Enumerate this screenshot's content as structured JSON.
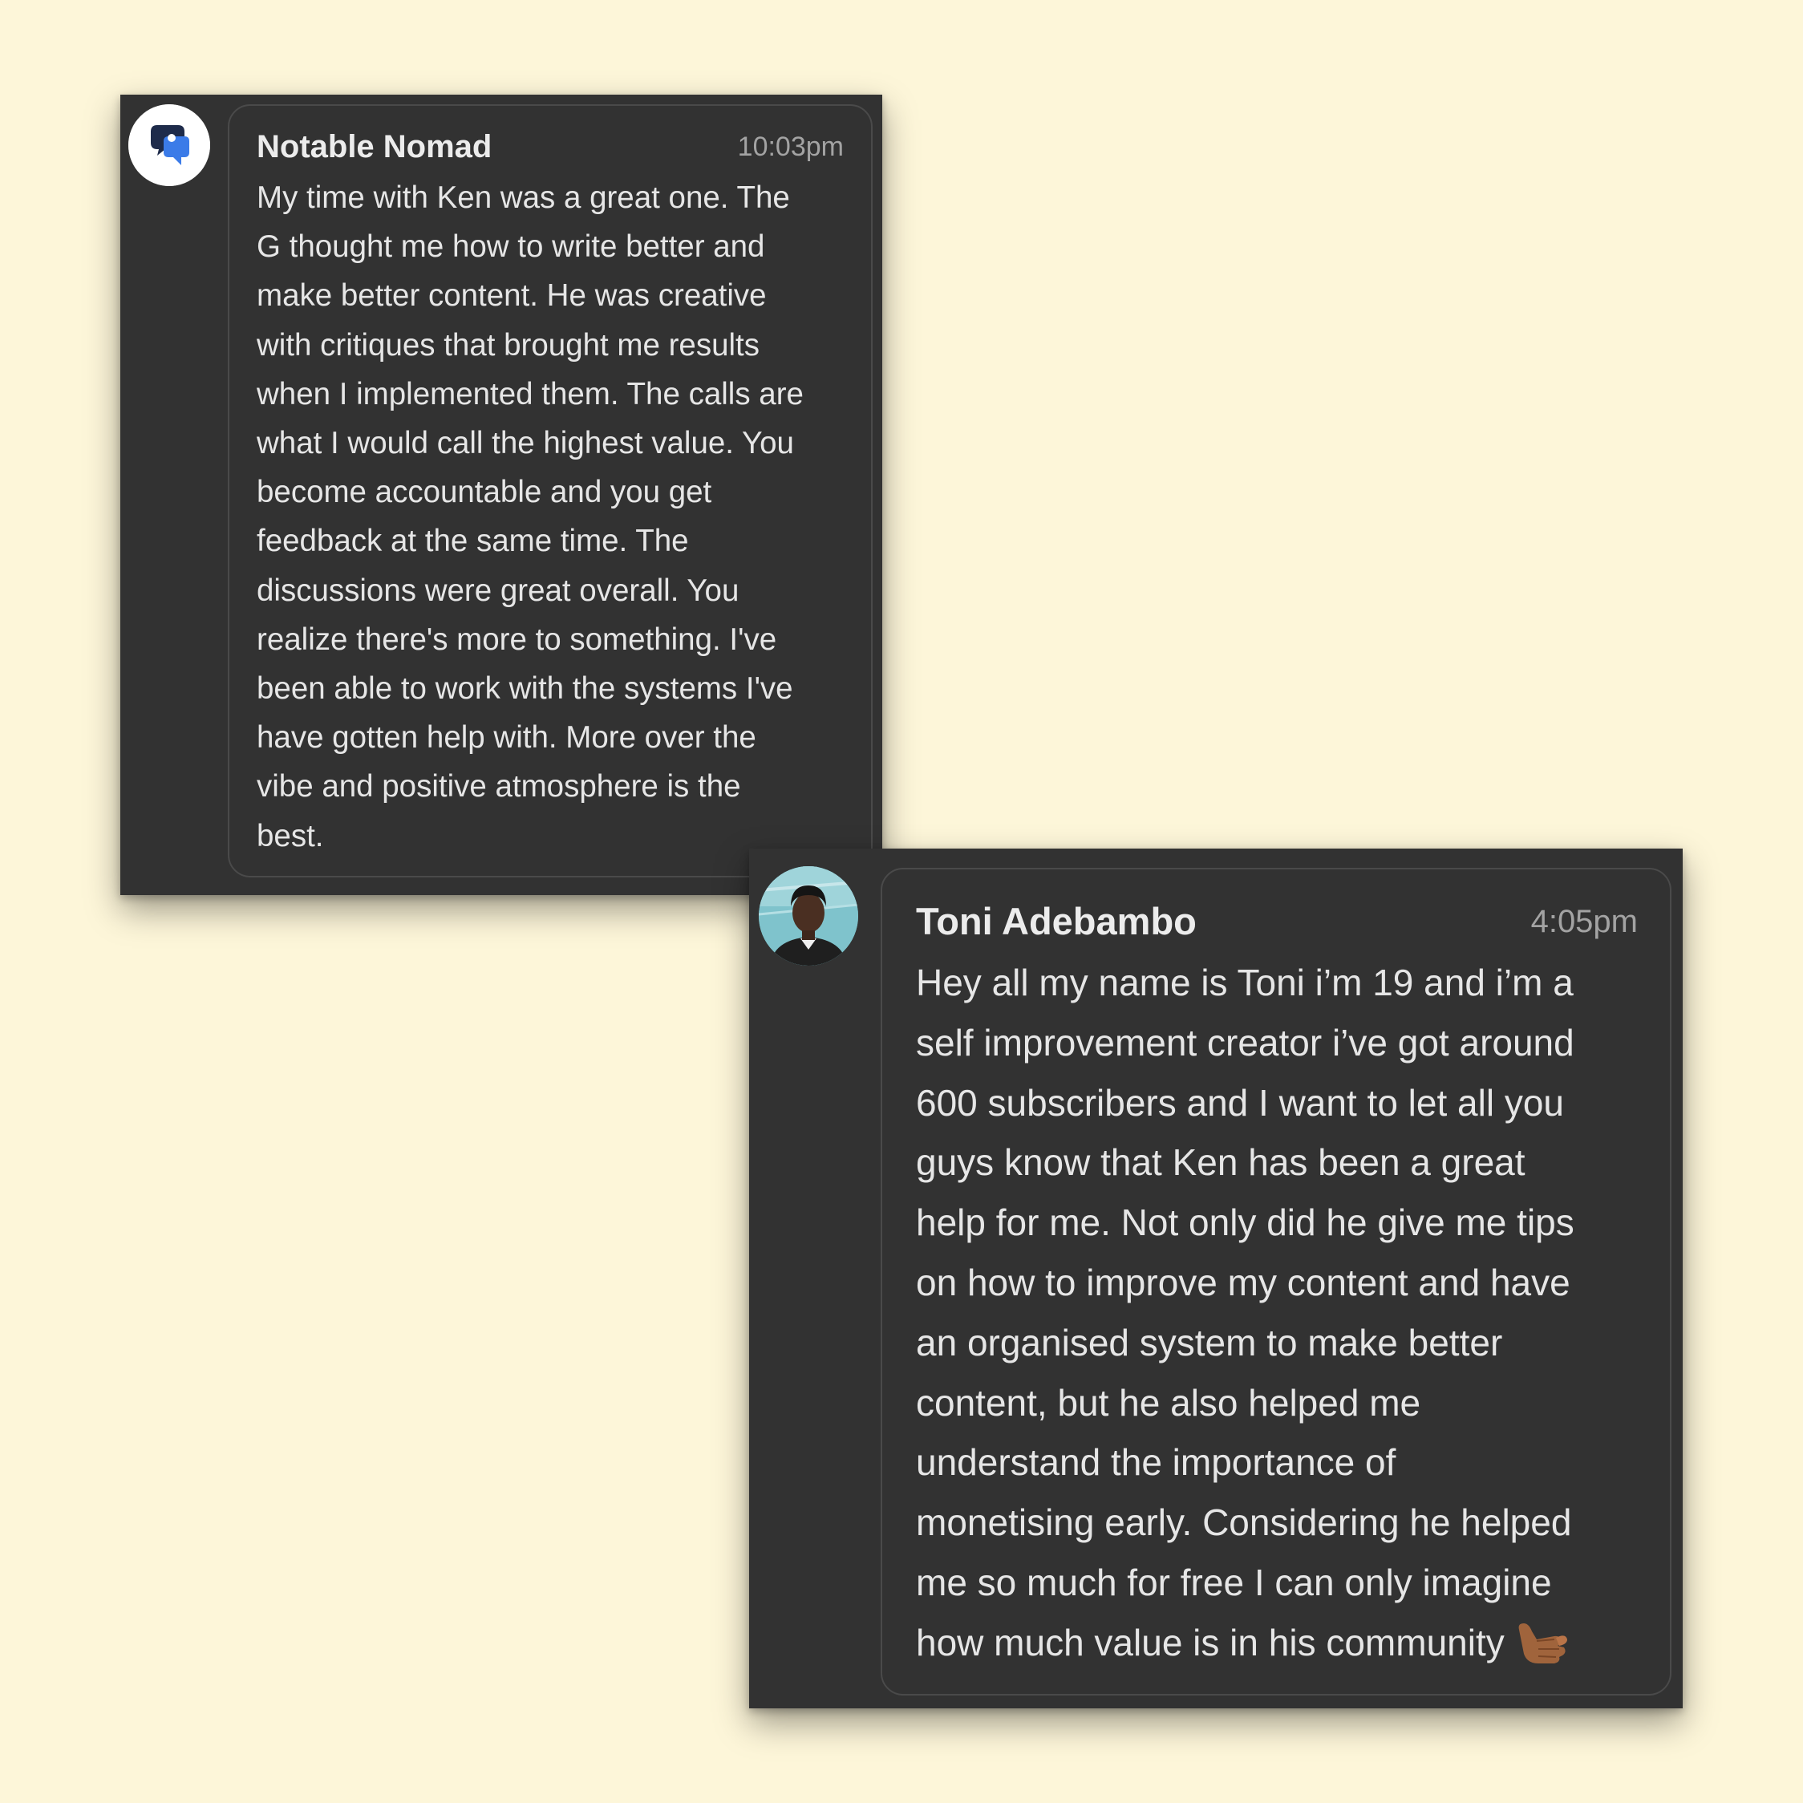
{
  "messages": [
    {
      "author": "Notable Nomad",
      "time": "10:03pm",
      "avatar_icon": "notable-nomad-logo-icon",
      "lines": [
        "My time with Ken was a great one. The",
        "G thought me how to write better and",
        "make better content. He was creative",
        "with critiques that brought me results",
        "when I implemented them. The calls are",
        "what I would call the highest value. You",
        "become accountable and you get",
        "feedback at the same time. The",
        "discussions were great overall. You",
        "realize there's more to something. I've",
        "been able to work with the systems I've",
        "have gotten help with. More over the",
        "vibe and positive atmosphere is the",
        "best."
      ]
    },
    {
      "author": "Toni Adebambo",
      "time": "4:05pm",
      "avatar_icon": "user-photo-avatar",
      "lines": [
        "Hey all my name is Toni i’m 19 and i’m a",
        "self improvement creator i’ve got around",
        "600 subscribers and I want to let all you",
        "guys know that Ken has been a great",
        "help for me. Not only did he give me tips",
        "on how to improve my content and have",
        "an organised system to make better",
        "content, but he also helped me",
        "understand the importance of",
        "monetising early. Considering he helped",
        "me so much for free I can only imagine",
        "how much value is in his community"
      ],
      "trailing_emoji": "call-me-hand-emoji"
    }
  ],
  "colors": {
    "background": "#fdf6d9",
    "card": "#323232",
    "bubble_border": "#4a4a4a",
    "name_text": "#ececec",
    "body_text": "#e6e6e6",
    "time_text": "#a3a3a3",
    "logo_dark": "#1e2b4a",
    "logo_blue": "#3b7be8"
  }
}
